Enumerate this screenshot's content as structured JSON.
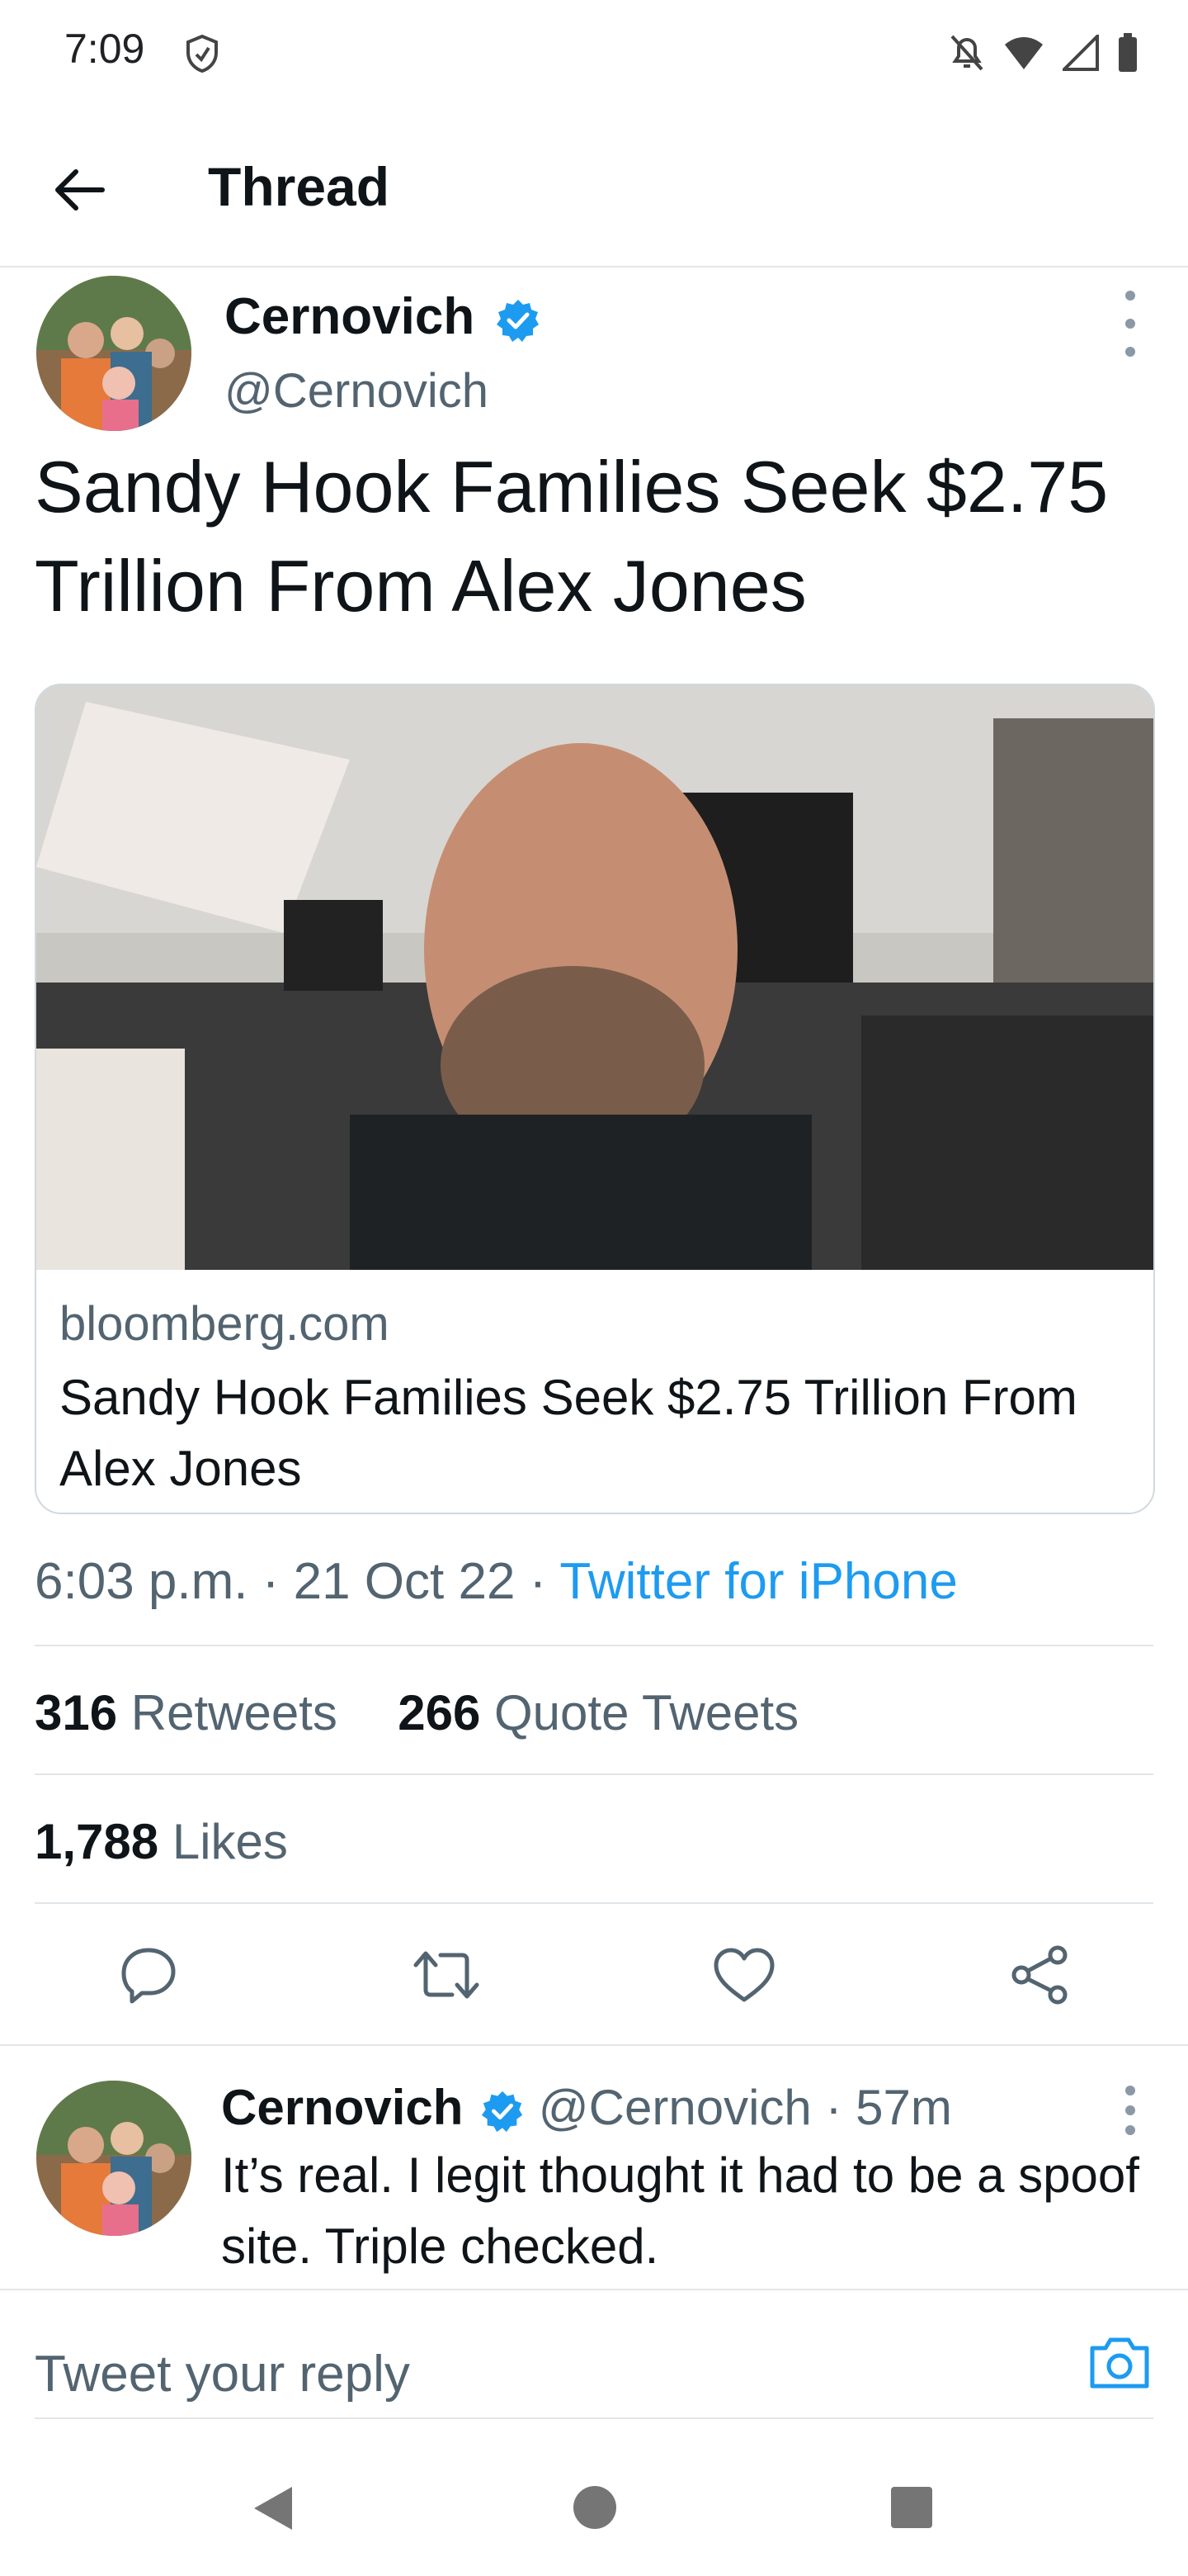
{
  "status_bar": {
    "time": "7:09"
  },
  "header": {
    "title": "Thread"
  },
  "tweet": {
    "author_name": "Cernovich",
    "handle": "@Cernovich",
    "text": "Sandy Hook Families Seek $2.75 Trillion From Alex Jones",
    "card": {
      "domain": "bloomberg.com",
      "title": "Sandy Hook Families Seek $2.75 Trillion From Alex Jones"
    },
    "time": "6:03 p.m.",
    "date": "21 Oct 22",
    "source": "Twitter for iPhone",
    "retweets_count": "316",
    "retweets_label": "Retweets",
    "quotes_count": "266",
    "quotes_label": "Quote Tweets",
    "likes_count": "1,788",
    "likes_label": "Likes"
  },
  "reply": {
    "author_name": "Cernovich",
    "handle": "@Cernovich",
    "time": "57m",
    "text": "It’s real. I legit thought it had to be a spoof site. Triple checked."
  },
  "composer": {
    "placeholder": "Tweet your reply"
  },
  "colors": {
    "accent": "#1d9bf0",
    "secondary_text": "#536471",
    "divider": "#e1e6ea"
  }
}
